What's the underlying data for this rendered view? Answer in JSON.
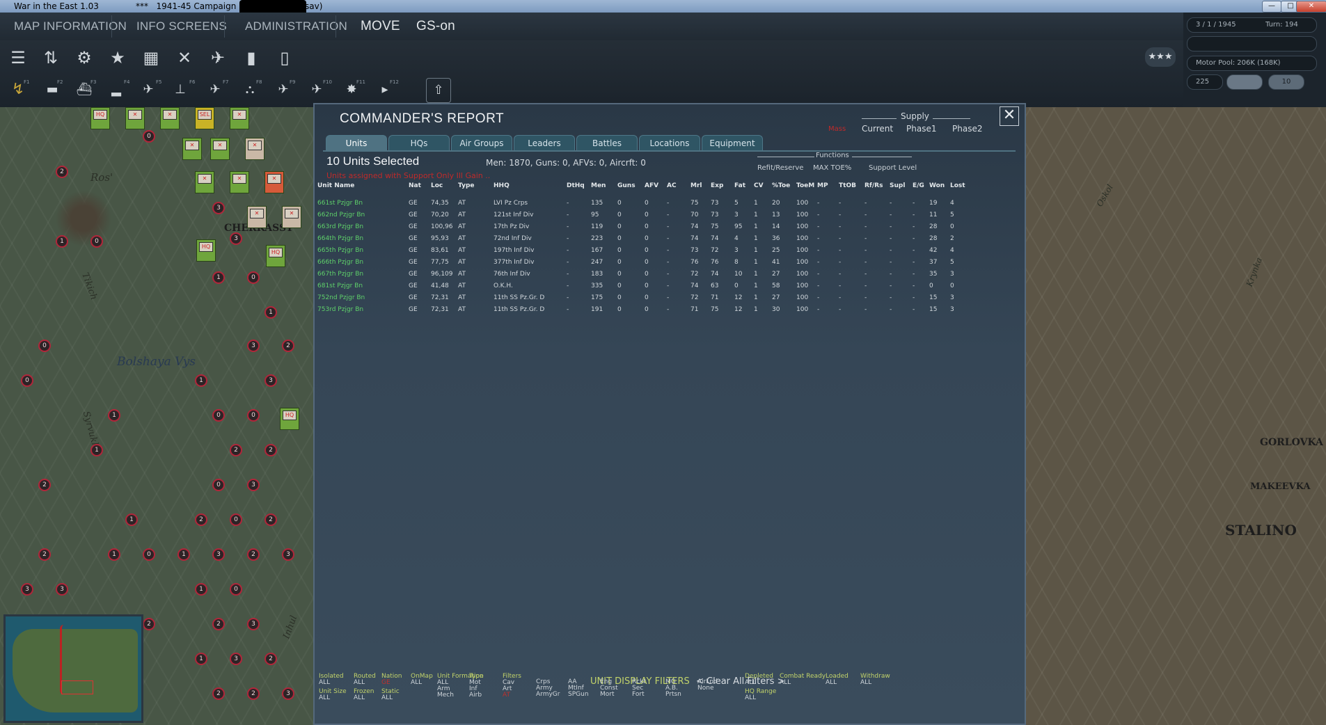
{
  "window": {
    "title": "War in the East 1.03",
    "title_suffix": "***   1941-45 Campaign   ***",
    "title_end": "sav)",
    "buttons": [
      "—",
      "□",
      "✕"
    ]
  },
  "topmenu": {
    "map_information": "MAP INFORMATION",
    "info_screens": "INFO SCREENS",
    "administration": "ADMINISTRATION",
    "move": "MOVE",
    "gs_on": "GS-on"
  },
  "toolbar": {
    "row1_icons": [
      "stack-icon",
      "sliders-icon",
      "gear-icon",
      "star-icon",
      "weather-icon",
      "crossed-arrows-icon",
      "satellite-icon",
      "fuel-icon",
      "document-icon"
    ],
    "row2_keys": [
      "F1",
      "F2",
      "F3",
      "F4",
      "F5",
      "F6",
      "F7",
      "F8",
      "F9",
      "F10",
      "F11",
      "F12"
    ],
    "stars_label": "★★★"
  },
  "status_panel": {
    "date": "3 / 1 / 1945",
    "turn": "Turn: 194",
    "motor_pool": "Motor Pool: 206K (168K)",
    "value": "225",
    "zoom": "10"
  },
  "map": {
    "labels": [
      "Ros'",
      "Bolshaya Vys",
      "Tikich",
      "Syrvukha",
      "Inhul"
    ],
    "towns": [
      "CHERKASSY",
      "GORLOVKA",
      "MAKEEVKA",
      "STALINO"
    ],
    "right_rivers": [
      "Oskol",
      "Krynka"
    ]
  },
  "report": {
    "title": "COMMANDER'S REPORT",
    "supply_header": "Supply",
    "supply_cols": [
      "Current",
      "Phase1",
      "Phase2"
    ],
    "supply_marker": "Mass",
    "tabs": [
      "Units",
      "HQs",
      "Air Groups",
      "Leaders",
      "Battles",
      "Locations",
      "Equipment"
    ],
    "selected": "10 Units Selected",
    "totals": "Men: 1870, Guns: 0, AFVs: 0, Aircrft: 0",
    "red_message": "Units assigned with Support Only Ill Gain ..",
    "functions_header": "Functions",
    "function_items": [
      "Refit/Reserve",
      "MAX TOE%",
      "Support Level"
    ],
    "columns": [
      "Unit Name",
      "Nat",
      "Loc",
      "Type",
      "HHQ",
      "DtHq",
      "Men",
      "Guns",
      "AFV",
      "AC",
      "Mrl",
      "Exp",
      "Fat",
      "CV",
      "%Toe",
      "ToeM",
      "MP",
      "TtOB",
      "Rf/Rs",
      "Supl",
      "E/G",
      "Won",
      "Lost"
    ],
    "rows": [
      [
        "661st Pzjgr Bn",
        "GE",
        "74,35",
        "AT",
        "LVI Pz Crps",
        "-",
        "135",
        "0",
        "0",
        "-",
        "75",
        "73",
        "5",
        "1",
        "20",
        "100",
        "-",
        "-",
        "-",
        "-",
        "-",
        "19",
        "4"
      ],
      [
        "662nd Pzjgr Bn",
        "GE",
        "70,20",
        "AT",
        "121st Inf Div",
        "-",
        "95",
        "0",
        "0",
        "-",
        "70",
        "73",
        "3",
        "1",
        "13",
        "100",
        "-",
        "-",
        "-",
        "-",
        "-",
        "11",
        "5"
      ],
      [
        "663rd Pzjgr Bn",
        "GE",
        "100,96",
        "AT",
        "17th Pz Div",
        "-",
        "119",
        "0",
        "0",
        "-",
        "74",
        "75",
        "95",
        "1",
        "14",
        "100",
        "-",
        "-",
        "-",
        "-",
        "-",
        "28",
        "0"
      ],
      [
        "664th Pzjgr Bn",
        "GE",
        "95,93",
        "AT",
        "72nd Inf Div",
        "-",
        "223",
        "0",
        "0",
        "-",
        "74",
        "74",
        "4",
        "1",
        "36",
        "100",
        "-",
        "-",
        "-",
        "-",
        "-",
        "28",
        "2"
      ],
      [
        "665th Pzjgr Bn",
        "GE",
        "83,61",
        "AT",
        "197th Inf Div",
        "-",
        "167",
        "0",
        "0",
        "-",
        "73",
        "72",
        "3",
        "1",
        "25",
        "100",
        "-",
        "-",
        "-",
        "-",
        "-",
        "42",
        "4"
      ],
      [
        "666th Pzjgr Bn",
        "GE",
        "77,75",
        "AT",
        "377th Inf Div",
        "-",
        "247",
        "0",
        "0",
        "-",
        "76",
        "76",
        "8",
        "1",
        "41",
        "100",
        "-",
        "-",
        "-",
        "-",
        "-",
        "37",
        "5"
      ],
      [
        "667th Pzjgr Bn",
        "GE",
        "96,109",
        "AT",
        "76th Inf Div",
        "-",
        "183",
        "0",
        "0",
        "-",
        "72",
        "74",
        "10",
        "1",
        "27",
        "100",
        "-",
        "-",
        "-",
        "-",
        "-",
        "35",
        "3"
      ],
      [
        "681st Pzjgr Bn",
        "GE",
        "41,48",
        "AT",
        "O.K.H.",
        "-",
        "335",
        "0",
        "0",
        "-",
        "74",
        "63",
        "0",
        "1",
        "58",
        "100",
        "-",
        "-",
        "-",
        "-",
        "-",
        "0",
        "0"
      ],
      [
        "752nd Pzjgr Bn",
        "GE",
        "72,31",
        "AT",
        "11th SS Pz.Gr. D",
        "-",
        "175",
        "0",
        "0",
        "-",
        "72",
        "71",
        "12",
        "1",
        "27",
        "100",
        "-",
        "-",
        "-",
        "-",
        "-",
        "15",
        "3"
      ],
      [
        "753rd Pzjgr Bn",
        "GE",
        "72,31",
        "AT",
        "11th SS Pz.Gr. D",
        "-",
        "191",
        "0",
        "0",
        "-",
        "71",
        "75",
        "12",
        "1",
        "30",
        "100",
        "-",
        "-",
        "-",
        "-",
        "-",
        "15",
        "3"
      ]
    ]
  },
  "filters": {
    "title": "UNIT DISPLAY FILTERS",
    "clear": "< Clear All Filters >",
    "groups": [
      {
        "h": "Isolated",
        "v": [
          "ALL"
        ]
      },
      {
        "h": "Routed",
        "v": [
          "ALL"
        ]
      },
      {
        "h": "Nation",
        "v": [
          "GE"
        ]
      },
      {
        "h": "OnMap",
        "v": [
          "ALL"
        ]
      },
      {
        "h": "Unit Formation",
        "v": [
          "ALL",
          "Arm",
          "Mech"
        ]
      },
      {
        "h": "Type",
        "v": [
          "Mot",
          "Inf",
          "Airb"
        ]
      },
      {
        "h": "Filters",
        "v": [
          "Cav",
          "Art",
          "AT"
        ]
      },
      {
        "h": "",
        "v": [
          "Crps",
          "Army",
          "ArmyGr"
        ]
      },
      {
        "h": "",
        "v": [
          "AA",
          "MtInf",
          "SPGun"
        ]
      },
      {
        "h": "",
        "v": [
          "Eng",
          "Const",
          "Mort"
        ]
      },
      {
        "h": "",
        "v": [
          "Rckt",
          "Sec",
          "Fort"
        ]
      },
      {
        "h": "",
        "v": [
          "MG",
          "A.B.",
          "Prtsn"
        ]
      },
      {
        "h": "",
        "v": [
          "AirLnd",
          "None"
        ]
      },
      {
        "h": "Depleted",
        "v": [
          "ALL"
        ]
      },
      {
        "h": "Combat Ready",
        "v": [
          "ALL"
        ]
      },
      {
        "h": "Loaded",
        "v": [
          "ALL"
        ]
      },
      {
        "h": "Withdraw",
        "v": [
          "ALL"
        ]
      },
      {
        "h": "Unit Size",
        "v": [
          "ALL"
        ]
      },
      {
        "h": "Frozen",
        "v": [
          "ALL"
        ]
      },
      {
        "h": "Static",
        "v": [
          "ALL"
        ]
      },
      {
        "h": "HQ Range",
        "v": [
          "ALL"
        ]
      }
    ]
  }
}
